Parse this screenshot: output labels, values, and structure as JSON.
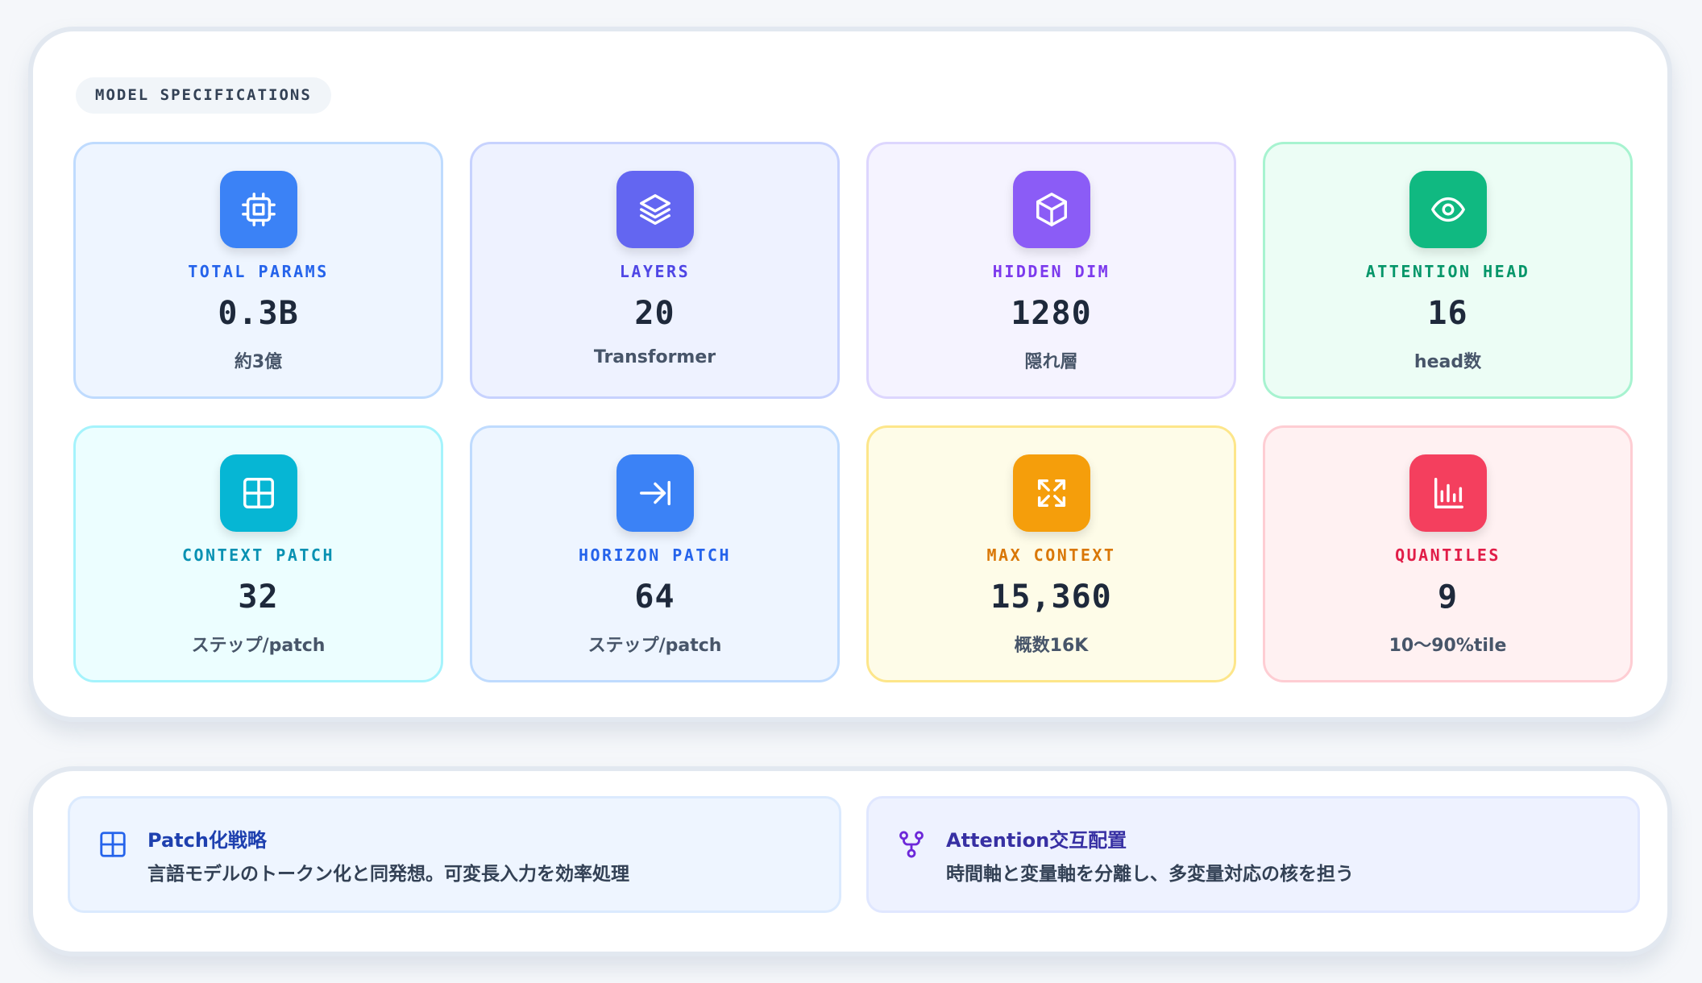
{
  "specs": {
    "section_label": "MODEL SPECIFICATIONS",
    "cards": [
      {
        "label": "TOTAL PARAMS",
        "value": "0.3B",
        "sub": "約3億",
        "icon": "cpu-icon",
        "accent": "#3b82f6"
      },
      {
        "label": "LAYERS",
        "value": "20",
        "sub": "Transformer",
        "icon": "layers-icon",
        "accent": "#6366f1"
      },
      {
        "label": "HIDDEN DIM",
        "value": "1280",
        "sub": "隠れ層",
        "icon": "cube-icon",
        "accent": "#8b5cf6"
      },
      {
        "label": "ATTENTION HEAD",
        "value": "16",
        "sub": "head数",
        "icon": "eye-icon",
        "accent": "#10b981"
      },
      {
        "label": "CONTEXT PATCH",
        "value": "32",
        "sub": "ステップ/patch",
        "icon": "grid-icon",
        "accent": "#06b6d4"
      },
      {
        "label": "HORIZON PATCH",
        "value": "64",
        "sub": "ステップ/patch",
        "icon": "arrow-to-right-icon",
        "accent": "#3b82f6"
      },
      {
        "label": "MAX CONTEXT",
        "value": "15,360",
        "sub": "概数16K",
        "icon": "expand-icon",
        "accent": "#f59e0b"
      },
      {
        "label": "QUANTILES",
        "value": "9",
        "sub": "10〜90%tile",
        "icon": "bar-chart-icon",
        "accent": "#f43f5e"
      }
    ]
  },
  "notes": [
    {
      "title": "Patch化戦略",
      "text": "言語モデルのトークン化と同発想。可変長入力を効率処理",
      "icon": "grid-icon",
      "accent": "#1e40af"
    },
    {
      "title": "Attention交互配置",
      "text": "時間軸と変量軸を分離し、多変量対応の核を担う",
      "icon": "git-fork-icon",
      "accent": "#3730a3"
    }
  ]
}
